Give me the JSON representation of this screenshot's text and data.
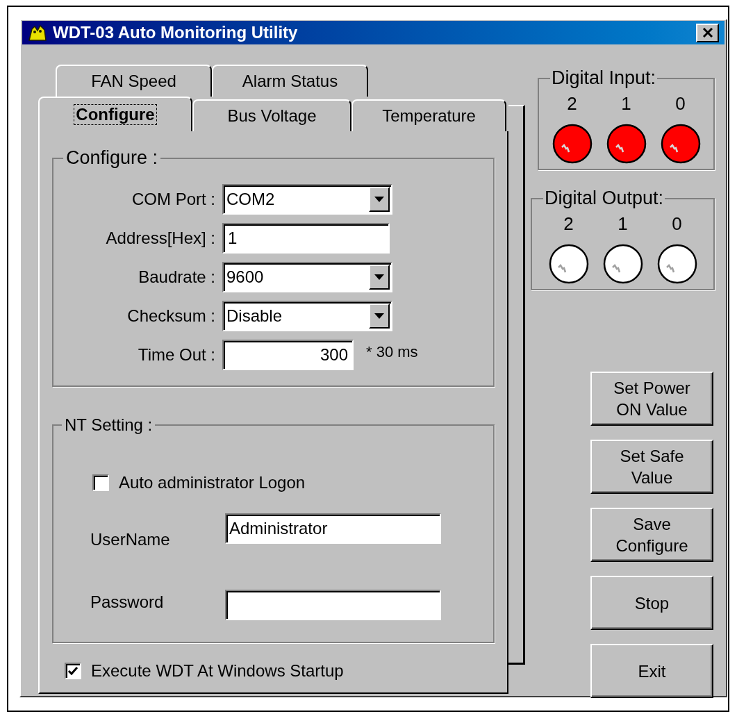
{
  "window": {
    "title": "WDT-03 Auto Monitoring Utility"
  },
  "tab_rows": [
    {
      "tabs": [
        {
          "label": "FAN Speed",
          "selected": false
        },
        {
          "label": "Alarm Status",
          "selected": false
        }
      ]
    },
    {
      "tabs": [
        {
          "label": "Configure",
          "selected": true
        },
        {
          "label": "Bus Voltage",
          "selected": false
        },
        {
          "label": "Temperature",
          "selected": false
        }
      ]
    }
  ],
  "configure": {
    "title": "Configure :",
    "fields": [
      {
        "label": "COM Port :",
        "kind": "dropdown",
        "value": "COM2"
      },
      {
        "label": "Address[Hex] :",
        "kind": "text",
        "value": "1"
      },
      {
        "label": "Baudrate :",
        "kind": "dropdown",
        "value": "9600"
      },
      {
        "label": "Checksum :",
        "kind": "dropdown",
        "value": "Disable"
      },
      {
        "label": "Time Out :",
        "kind": "number",
        "value": "300",
        "suffix": "* 30 ms"
      }
    ]
  },
  "nt_setting": {
    "title": "NT Setting :",
    "auto_logon": {
      "label": "Auto administrator Logon",
      "checked": false
    },
    "fields": [
      {
        "label": "UserName",
        "value": "Administrator"
      },
      {
        "label": "Password"
      }
    ]
  },
  "startup": {
    "label": "Execute WDT At Windows Startup",
    "checked": true
  },
  "digital_input": {
    "title": "Digital Input:",
    "leds": [
      {
        "label": "2",
        "on": true
      },
      {
        "label": "1",
        "on": true
      },
      {
        "label": "0",
        "on": true
      }
    ]
  },
  "digital_output": {
    "title": "Digital Output:",
    "leds": [
      {
        "label": "2",
        "on": false
      },
      {
        "label": "1",
        "on": false
      },
      {
        "label": "0",
        "on": false
      }
    ]
  },
  "buttons": [
    "Set Power\nON Value",
    "Set Safe\nValue",
    "Save\nConfigure",
    "Stop",
    "Exit"
  ]
}
